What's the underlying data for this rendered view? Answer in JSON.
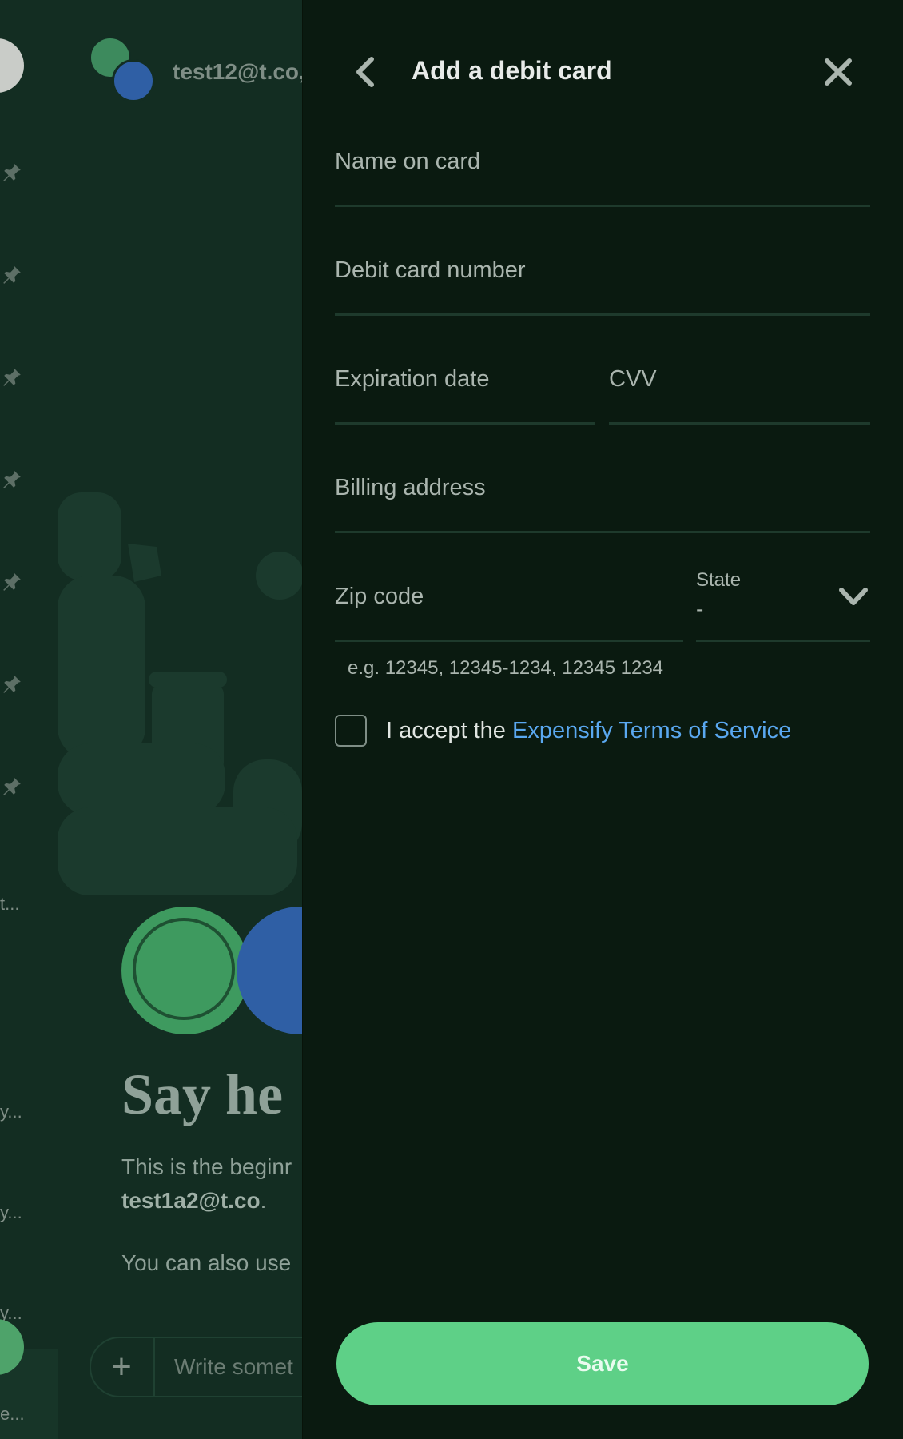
{
  "sidebar": {
    "pinned_count": 7,
    "truncated_items": [
      "t...",
      "y...",
      "y...",
      "y...",
      "e..."
    ]
  },
  "chat": {
    "header_title": "test12@t.co,",
    "welcome_title": "Say he",
    "welcome_line1": "This is the beginr",
    "welcome_email": "test1a2@t.co",
    "welcome_email_suffix": ".",
    "welcome_line3": "You can also use",
    "composer_placeholder": "Write somet"
  },
  "panel": {
    "title": "Add a debit card",
    "fields": {
      "name_label": "Name on card",
      "number_label": "Debit card number",
      "expiration_label": "Expiration date",
      "cvv_label": "CVV",
      "billing_label": "Billing address",
      "zip_label": "Zip code",
      "state_label": "State",
      "state_value": "-"
    },
    "zip_hint": "e.g. 12345, 12345-1234, 12345 1234",
    "terms_prefix": "I accept the ",
    "terms_link": "Expensify Terms of Service",
    "save_label": "Save"
  },
  "colors": {
    "panel_bg": "#0a1a10",
    "chat_bg": "#132d22",
    "accent_green": "#5ed087",
    "link_blue": "#5aa8f0"
  },
  "icons": {
    "back": "chevron-left-icon",
    "close": "close-icon",
    "state_dropdown": "chevron-down-icon",
    "pin": "pin-icon",
    "composer_add": "plus-icon"
  }
}
